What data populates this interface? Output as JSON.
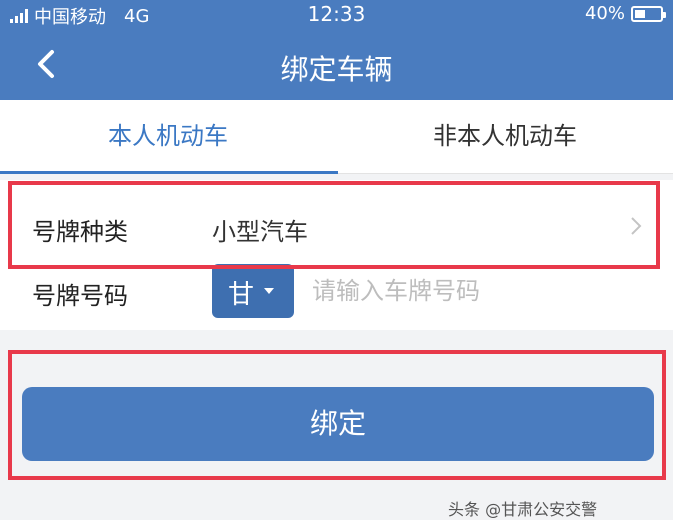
{
  "status_bar": {
    "carrier": "中国移动",
    "network": "4G",
    "time": "12:33",
    "battery": "40%",
    "battery_level": 0.4
  },
  "header": {
    "title": "绑定车辆",
    "back_icon": "chevron-left-icon"
  },
  "tabs": [
    {
      "label": "本人机动车",
      "active": true
    },
    {
      "label": "非本人机动车",
      "active": false
    }
  ],
  "form": {
    "plate_type_label": "号牌种类",
    "plate_type_value": "小型汽车",
    "plate_number_label": "号牌号码",
    "province_value": "甘",
    "plate_number_placeholder": "请输入车牌号码"
  },
  "actions": {
    "bind_label": "绑定"
  },
  "watermark": "头条 @甘肃公安交警",
  "colors": {
    "primary": "#4a7cbf",
    "accent": "#3b78c4",
    "highlight": "#e8394a"
  }
}
